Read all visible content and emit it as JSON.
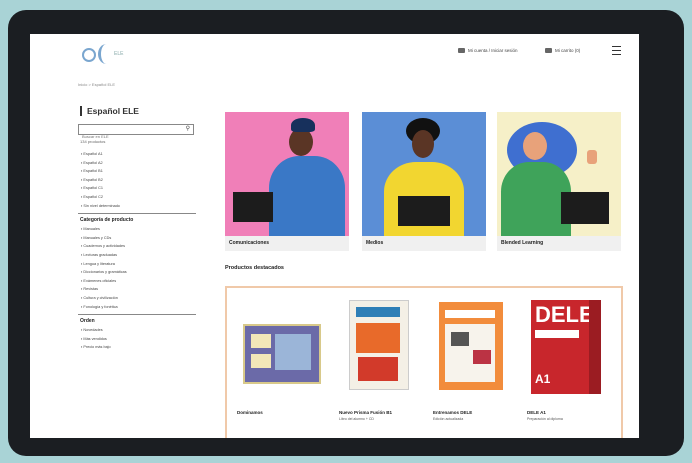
{
  "header": {
    "logo_text": "ELE",
    "account_label": "Mi cuenta / Iniciar sesión",
    "cart_label": "Mi carrito (0)"
  },
  "breadcrumb": "Inicio > Español ELE",
  "sidebar": {
    "title": "Español ELE",
    "search_placeholder": "Buscar en ELE",
    "found_text": "134 productos",
    "levels": [
      "Español A1",
      "Español A2",
      "Español B1",
      "Español B2",
      "Español C1",
      "Español C2",
      "Sin nivel determinado"
    ],
    "category_title": "Categoría de producto",
    "categories": [
      "Manuales",
      "Manuales y CDs",
      "Cuadernos y actividades",
      "Lecturas graduadas",
      "Lengua y literatura",
      "Diccionarios y gramáticas",
      "Exámenes oficiales",
      "Revistas",
      "Cultura y civilización",
      "Fonología y fonética"
    ],
    "sort_title": "Orden",
    "sort_items": [
      "Novedades",
      "Más vendidos",
      "Precio más bajo"
    ]
  },
  "cards": [
    {
      "label": "Comunicaciones",
      "bg": "#f07fb8"
    },
    {
      "label": "Medios",
      "bg": "#5b8ed6"
    },
    {
      "label": "Blended Learning",
      "bg": "#f6f0c8"
    }
  ],
  "products_title": "Productos destacados",
  "products": [
    {
      "name": "Dominamos",
      "sub": ""
    },
    {
      "name": "Nuevo Prisma Fusión B1",
      "sub": "Libro del alumno + CD"
    },
    {
      "name": "Entrenamos DELE",
      "sub": "Edición actualizada"
    },
    {
      "name": "DELE A1",
      "sub": "Preparación al diploma"
    }
  ],
  "colors": {
    "accent_border": "#f0c9a9",
    "bezel": "#1b1e22",
    "background": "#a9d3d6"
  }
}
